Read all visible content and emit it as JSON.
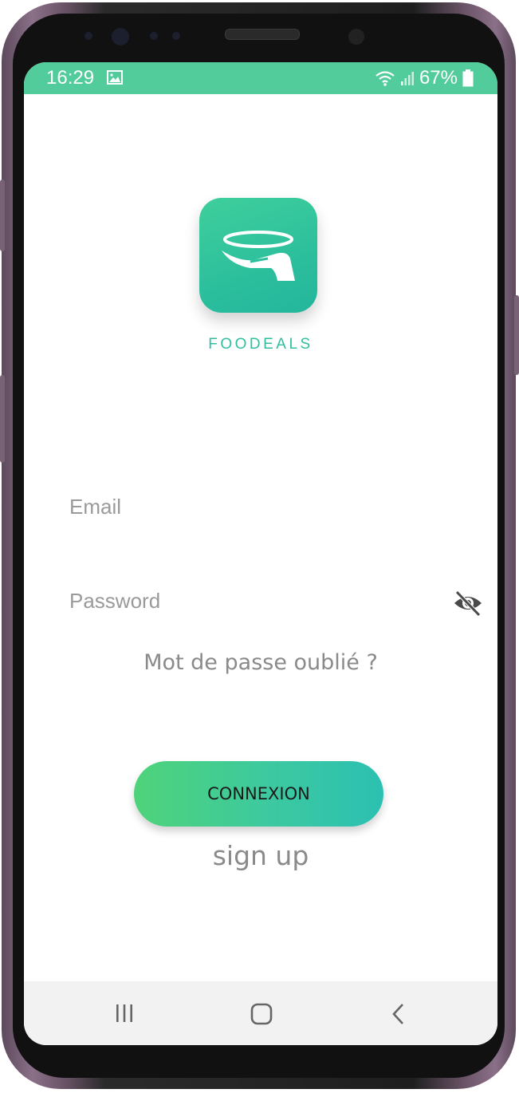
{
  "status_bar": {
    "time": "16:29",
    "battery": "67%",
    "icons": [
      "image-icon",
      "wifi-icon",
      "signal-icon",
      "battery-icon"
    ]
  },
  "app": {
    "name": "FOODEALS",
    "logo_icon": "hand-with-halo-icon",
    "accent_color": "#2fbf9f"
  },
  "form": {
    "email_placeholder": "Email",
    "password_placeholder": "Password",
    "password_toggle_icon": "eye-off-icon",
    "forgot_password": "Mot de passe oublié ?",
    "login_button": "CONNEXION",
    "signup_link": "sign up"
  },
  "nav_bar": {
    "icons": [
      "recent-apps-icon",
      "home-icon",
      "back-icon"
    ]
  }
}
